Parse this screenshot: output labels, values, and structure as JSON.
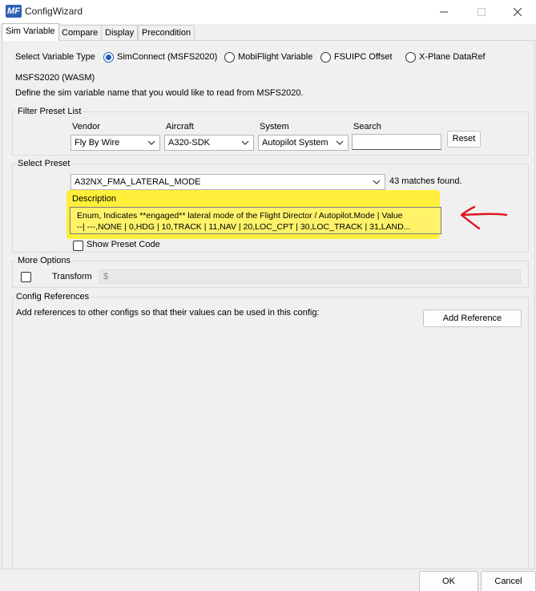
{
  "window": {
    "title": "ConfigWizard",
    "logo_text": "MF"
  },
  "tabs": [
    {
      "label": "Sim Variable",
      "active": true
    },
    {
      "label": "Compare",
      "active": false
    },
    {
      "label": "Display",
      "active": false
    },
    {
      "label": "Precondition",
      "active": false
    }
  ],
  "variable_type": {
    "label": "Select Variable Type",
    "options": [
      {
        "label": "SimConnect (MSFS2020)",
        "checked": true
      },
      {
        "label": "MobiFlight Variable",
        "checked": false
      },
      {
        "label": "FSUIPC Offset",
        "checked": false
      },
      {
        "label": "X-Plane DataRef",
        "checked": false
      }
    ]
  },
  "msfs_group": {
    "title": "MSFS2020 (WASM)",
    "description": "Define the sim variable name that you would like to read from MSFS2020."
  },
  "filter": {
    "title": "Filter Preset List",
    "vendor_label": "Vendor",
    "vendor_value": "Fly By Wire",
    "aircraft_label": "Aircraft",
    "aircraft_value": "A320-SDK",
    "system_label": "System",
    "system_value": "Autopilot System",
    "search_label": "Search",
    "search_value": "",
    "reset_label": "Reset"
  },
  "preset": {
    "title": "Select Preset",
    "selected": "A32NX_FMA_LATERAL_MODE",
    "matches": "43 matches found.",
    "description_label": "Description",
    "description_line1": "Enum, Indicates **engaged** lateral mode of the Flight Director / Autopilot.Mode | Value",
    "description_line2": "--| ---,NONE | 0,HDG | 10,TRACK | 11,NAV | 20,LOC_CPT | 30,LOC_TRACK | 31,LAND...",
    "show_code_label": "Show Preset Code"
  },
  "more_options": {
    "title": "More Options",
    "transform_label": "Transform",
    "transform_value": "$"
  },
  "config_refs": {
    "title": "Config References",
    "description": "Add references to other configs so that their values can be used in this config:",
    "add_label": "Add Reference"
  },
  "footer": {
    "ok_label": "OK",
    "cancel_label": "Cancel"
  },
  "colors": {
    "highlight": "#ffef3b",
    "annotation_arrow": "#e0141e",
    "accent": "#1f5fbf"
  }
}
